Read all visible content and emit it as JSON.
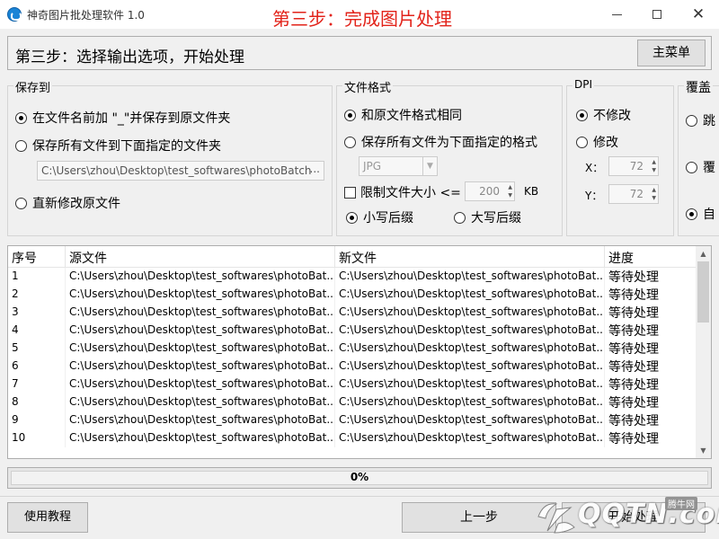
{
  "window": {
    "title": "神奇图片批处理软件 1.0",
    "step_title": "第三步：完成图片处理",
    "minimize": "",
    "maximize": "",
    "close": "✕"
  },
  "header": {
    "text": "第三步：选择输出选项，开始处理",
    "main_menu": "主菜单"
  },
  "save_to": {
    "title": "保存到",
    "option_prefix": "在文件名前加 \"_\"并保存到原文件夹",
    "option_folder": "保存所有文件到下面指定的文件夹",
    "folder_path": "C:\\Users\\zhou\\Desktop\\test_softwares\\photoBatch",
    "browse": "...",
    "option_overwrite": "直新修改原文件",
    "selected": "option_prefix"
  },
  "file_format": {
    "title": "文件格式",
    "option_same": "和原文件格式相同",
    "option_convert": "保存所有文件为下面指定的格式",
    "format_value": "JPG",
    "limit_size_label": "限制文件大小 <=",
    "limit_size_value": "200",
    "limit_size_unit": "KB",
    "limit_size_checked": false,
    "option_lower_ext": "小写后缀",
    "option_upper_ext": "大写后缀",
    "selected": "option_same",
    "ext_selected": "option_lower_ext"
  },
  "dpi": {
    "title": "DPI",
    "option_keep": "不修改",
    "option_modify": "修改",
    "x_label": "X：",
    "x_value": "72",
    "y_label": "Y：",
    "y_value": "72",
    "selected": "option_keep"
  },
  "cover": {
    "title": "覆盖",
    "option_1": "跳",
    "option_2": "覆",
    "option_3": "自",
    "selected": "option_3"
  },
  "table": {
    "headers": [
      "序号",
      "源文件",
      "新文件",
      "进度"
    ],
    "rows": [
      {
        "no": "1",
        "src": "C:\\Users\\zhou\\Desktop\\test_softwares\\photoBat...",
        "dst": "C:\\Users\\zhou\\Desktop\\test_softwares\\photoBat...",
        "status": "等待处理"
      },
      {
        "no": "2",
        "src": "C:\\Users\\zhou\\Desktop\\test_softwares\\photoBat...",
        "dst": "C:\\Users\\zhou\\Desktop\\test_softwares\\photoBat...",
        "status": "等待处理"
      },
      {
        "no": "3",
        "src": "C:\\Users\\zhou\\Desktop\\test_softwares\\photoBat...",
        "dst": "C:\\Users\\zhou\\Desktop\\test_softwares\\photoBat...",
        "status": "等待处理"
      },
      {
        "no": "4",
        "src": "C:\\Users\\zhou\\Desktop\\test_softwares\\photoBat...",
        "dst": "C:\\Users\\zhou\\Desktop\\test_softwares\\photoBat...",
        "status": "等待处理"
      },
      {
        "no": "5",
        "src": "C:\\Users\\zhou\\Desktop\\test_softwares\\photoBat...",
        "dst": "C:\\Users\\zhou\\Desktop\\test_softwares\\photoBat...",
        "status": "等待处理"
      },
      {
        "no": "6",
        "src": "C:\\Users\\zhou\\Desktop\\test_softwares\\photoBat...",
        "dst": "C:\\Users\\zhou\\Desktop\\test_softwares\\photoBat...",
        "status": "等待处理"
      },
      {
        "no": "7",
        "src": "C:\\Users\\zhou\\Desktop\\test_softwares\\photoBat...",
        "dst": "C:\\Users\\zhou\\Desktop\\test_softwares\\photoBat...",
        "status": "等待处理"
      },
      {
        "no": "8",
        "src": "C:\\Users\\zhou\\Desktop\\test_softwares\\photoBat...",
        "dst": "C:\\Users\\zhou\\Desktop\\test_softwares\\photoBat...",
        "status": "等待处理"
      },
      {
        "no": "9",
        "src": "C:\\Users\\zhou\\Desktop\\test_softwares\\photoBat...",
        "dst": "C:\\Users\\zhou\\Desktop\\test_softwares\\photoBat...",
        "status": "等待处理"
      },
      {
        "no": "10",
        "src": "C:\\Users\\zhou\\Desktop\\test_softwares\\photoBat...",
        "dst": "C:\\Users\\zhou\\Desktop\\test_softwares\\photoBat...",
        "status": "等待处理"
      }
    ]
  },
  "progress": {
    "percent": 0,
    "label": "0%"
  },
  "footer": {
    "tutorial": "使用教程",
    "prev": "上一步",
    "next": "开始处理"
  },
  "watermark": {
    "text": "QQTN.com",
    "site": "腾牛网"
  },
  "colors": {
    "step_title": "#e2231a",
    "app_icon": "#1a84d6"
  }
}
